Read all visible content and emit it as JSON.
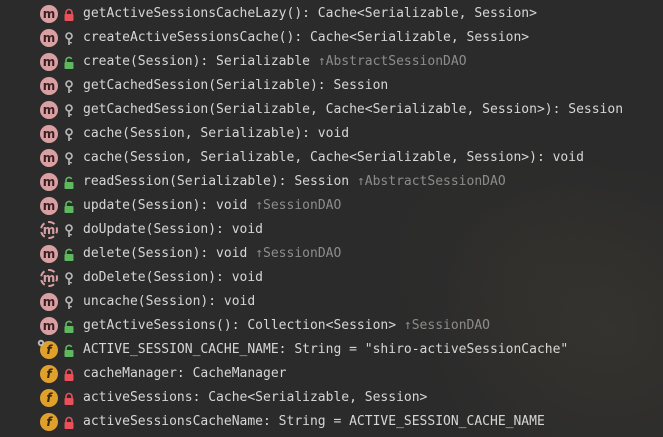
{
  "structure": {
    "items": [
      {
        "kind": "m",
        "visibility": "private",
        "signature": "getActiveSessionsCacheLazy(): Cache<Serializable, Session>",
        "origin": ""
      },
      {
        "kind": "m",
        "visibility": "protected",
        "signature": "createActiveSessionsCache(): Cache<Serializable, Session>",
        "origin": ""
      },
      {
        "kind": "m",
        "visibility": "public",
        "signature": "create(Session): Serializable",
        "origin": "↑AbstractSessionDAO"
      },
      {
        "kind": "m",
        "visibility": "protected",
        "signature": "getCachedSession(Serializable): Session",
        "origin": ""
      },
      {
        "kind": "m",
        "visibility": "protected",
        "signature": "getCachedSession(Serializable, Cache<Serializable, Session>): Session",
        "origin": ""
      },
      {
        "kind": "m",
        "visibility": "protected",
        "signature": "cache(Session, Serializable): void",
        "origin": ""
      },
      {
        "kind": "m",
        "visibility": "protected",
        "signature": "cache(Session, Serializable, Cache<Serializable, Session>): void",
        "origin": ""
      },
      {
        "kind": "m",
        "visibility": "public",
        "signature": "readSession(Serializable): Session",
        "origin": "↑AbstractSessionDAO"
      },
      {
        "kind": "m",
        "visibility": "public",
        "signature": "update(Session): void",
        "origin": "↑SessionDAO"
      },
      {
        "kind": "abstract",
        "visibility": "protected",
        "signature": "doUpdate(Session): void",
        "origin": ""
      },
      {
        "kind": "m",
        "visibility": "public",
        "signature": "delete(Session): void",
        "origin": "↑SessionDAO"
      },
      {
        "kind": "abstract",
        "visibility": "protected",
        "signature": "doDelete(Session): void",
        "origin": ""
      },
      {
        "kind": "m",
        "visibility": "protected",
        "signature": "uncache(Session): void",
        "origin": ""
      },
      {
        "kind": "m",
        "visibility": "public",
        "signature": "getActiveSessions(): Collection<Session>",
        "origin": "↑SessionDAO"
      },
      {
        "kind": "static",
        "visibility": "public",
        "signature": "ACTIVE_SESSION_CACHE_NAME: String = \"shiro-activeSessionCache\"",
        "origin": ""
      },
      {
        "kind": "f",
        "visibility": "private",
        "signature": "cacheManager: CacheManager",
        "origin": ""
      },
      {
        "kind": "f",
        "visibility": "private",
        "signature": "activeSessions: Cache<Serializable, Session>",
        "origin": ""
      },
      {
        "kind": "f",
        "visibility": "private",
        "signature": "activeSessionsCacheName: String = ACTIVE_SESSION_CACHE_NAME",
        "origin": ""
      }
    ]
  },
  "icons": {
    "method": "method-icon",
    "field": "field-icon",
    "abstract": "abstract-method-icon",
    "static_field": "static-field-icon",
    "private": "lock-icon",
    "protected": "key-icon",
    "public": "open-lock-icon"
  },
  "colors": {
    "background": "#2b2b2b",
    "method_badge": "#d9a0a4",
    "field_badge": "#e0a02c",
    "private_lock": "#e8515a",
    "protected_key": "#bbbbbb",
    "public_lock": "#5fb85f",
    "text": "#d6d6d6",
    "origin_text": "#8c8c8c"
  }
}
